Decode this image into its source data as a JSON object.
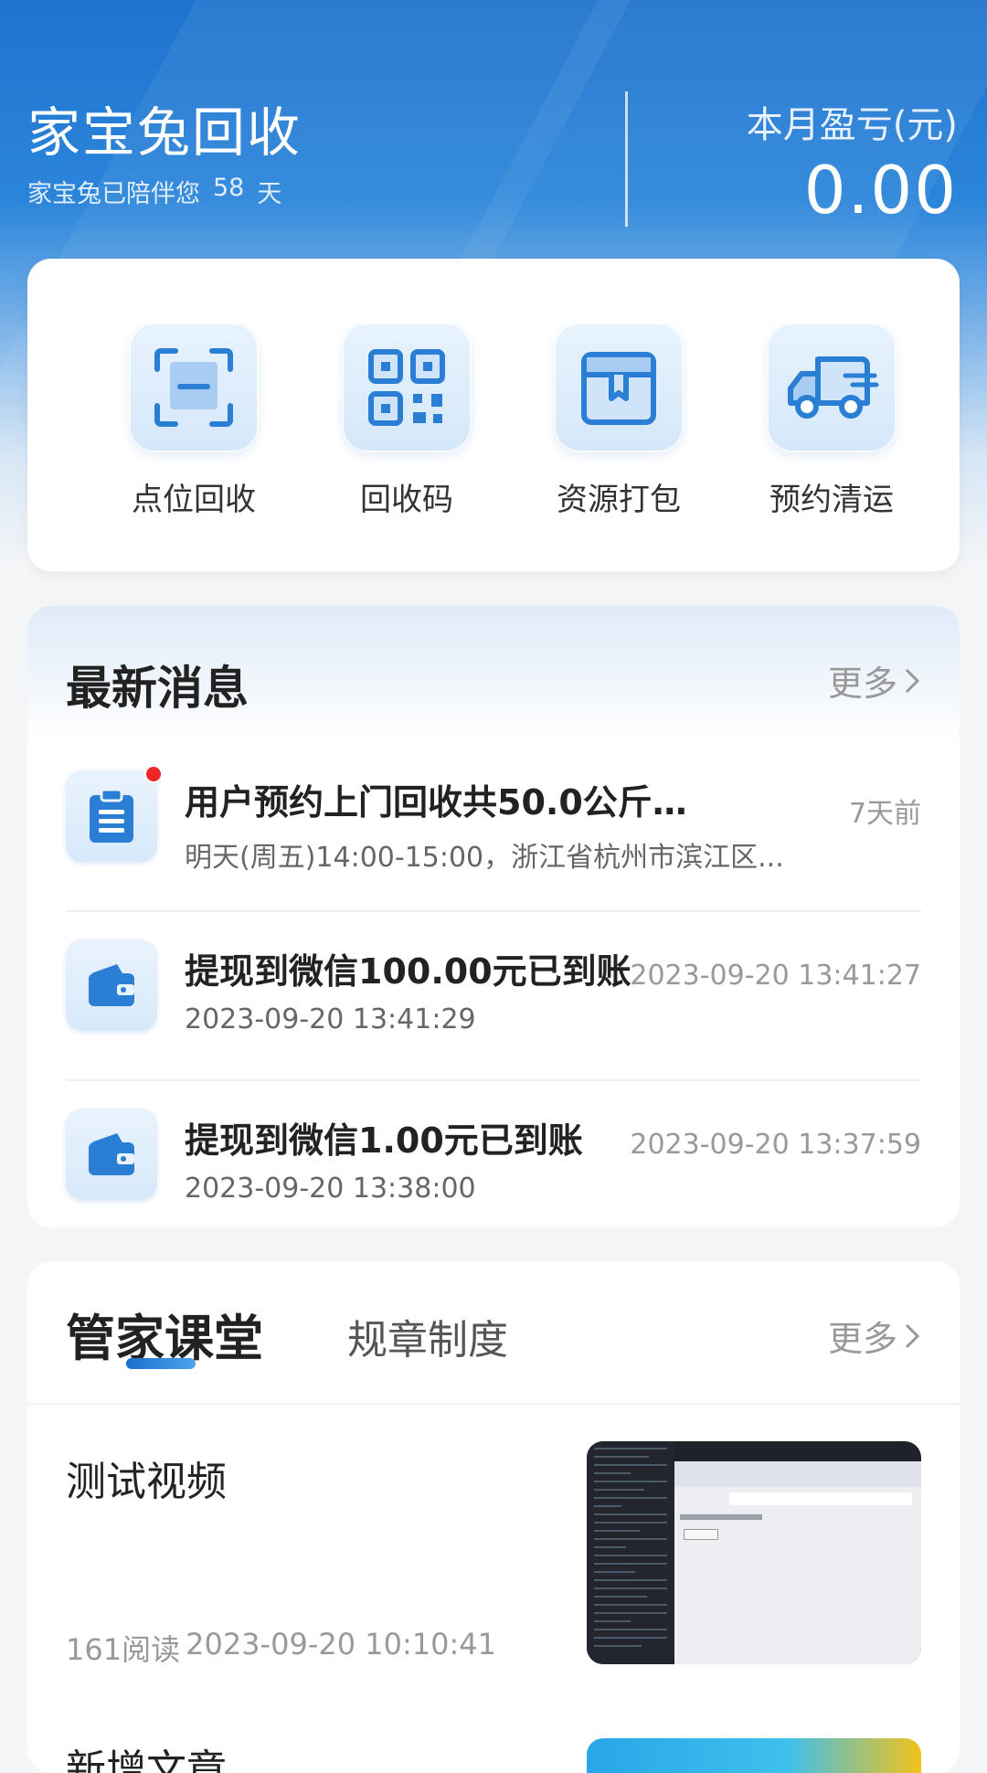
{
  "header": {
    "app_title": "家宝兔回收",
    "companion_prefix": "家宝兔已陪伴您",
    "companion_days": "58",
    "companion_suffix": "天",
    "profit_label": "本月盈亏(元)",
    "profit_value": "0.00"
  },
  "actions": [
    {
      "label": "点位回收",
      "icon": "scan-icon"
    },
    {
      "label": "回收码",
      "icon": "qr-code-icon"
    },
    {
      "label": "资源打包",
      "icon": "package-box-icon"
    },
    {
      "label": "预约清运",
      "icon": "delivery-truck-icon"
    }
  ],
  "news": {
    "title": "最新消息",
    "more": "更多",
    "items": [
      {
        "title": "用户预约上门回收共50.0公斤|0...",
        "subtitle": "明天(周五)14:00-15:00，浙江省杭州市滨江区...",
        "time": "7天前",
        "icon": "clipboard-icon",
        "unread": true
      },
      {
        "title": "提现到微信100.00元已到账",
        "subtitle": "2023-09-20 13:41:29",
        "time": "2023-09-20 13:41:27",
        "icon": "wallet-icon",
        "unread": false
      },
      {
        "title": "提现到微信1.00元已到账",
        "subtitle": "2023-09-20 13:38:00",
        "time": "2023-09-20 13:37:59",
        "icon": "wallet-icon",
        "unread": false
      }
    ]
  },
  "course": {
    "tab_active": "管家课堂",
    "tab_other": "规章制度",
    "more": "更多",
    "articles": [
      {
        "title": "测试视频",
        "reads": "161阅读",
        "date": "2023-09-20 10:10:41"
      },
      {
        "title": "新增文章"
      }
    ]
  },
  "colors": {
    "brand_blue": "#1f73cf",
    "accent_icon": "#2a7fd4",
    "unread_dot": "#f1242a"
  }
}
